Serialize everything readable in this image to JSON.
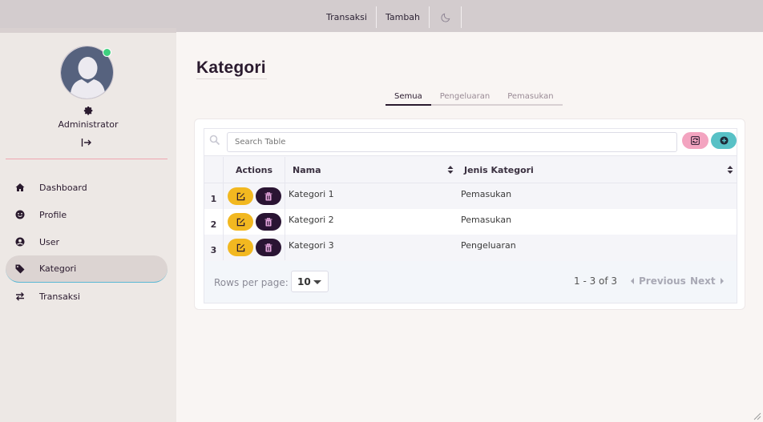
{
  "topnav": {
    "items": [
      "Transaksi",
      "Tambah"
    ],
    "theme_icon": "moon-icon"
  },
  "user": {
    "name": "Administrator",
    "status": "online"
  },
  "sidebar": {
    "items": [
      {
        "label": "Dashboard",
        "icon": "home-icon"
      },
      {
        "label": "Profile",
        "icon": "smile-icon"
      },
      {
        "label": "User",
        "icon": "user-circle-icon"
      },
      {
        "label": "Kategori",
        "icon": "tag-icon",
        "active": true
      },
      {
        "label": "Transaksi",
        "icon": "exchange-icon"
      }
    ]
  },
  "page": {
    "title": "Kategori",
    "tabs": [
      "Semua",
      "Pengeluaran",
      "Pemasukan"
    ],
    "active_tab": "Semua"
  },
  "table": {
    "search_placeholder": "Search Table",
    "columns": {
      "actions": "Actions",
      "nama": "Nama",
      "jenis": "Jenis Kategori"
    },
    "rows": [
      {
        "no": "1",
        "nama": "Kategori 1",
        "jenis": "Pemasukan"
      },
      {
        "no": "2",
        "nama": "Kategori 2",
        "jenis": "Pemasukan"
      },
      {
        "no": "3",
        "nama": "Kategori 3",
        "jenis": "Pengeluaran"
      }
    ],
    "footer": {
      "rows_per_page_label": "Rows per page:",
      "rows_per_page_value": "10",
      "range": "1 - 3 of 3",
      "previous": "Previous",
      "next": "Next"
    }
  },
  "colors": {
    "edit_button": "#f2b820",
    "delete_button": "#2a1433",
    "refresh_button": "#f3a4c0",
    "add_button": "#58c1c6",
    "online_dot": "#3fd07f"
  }
}
